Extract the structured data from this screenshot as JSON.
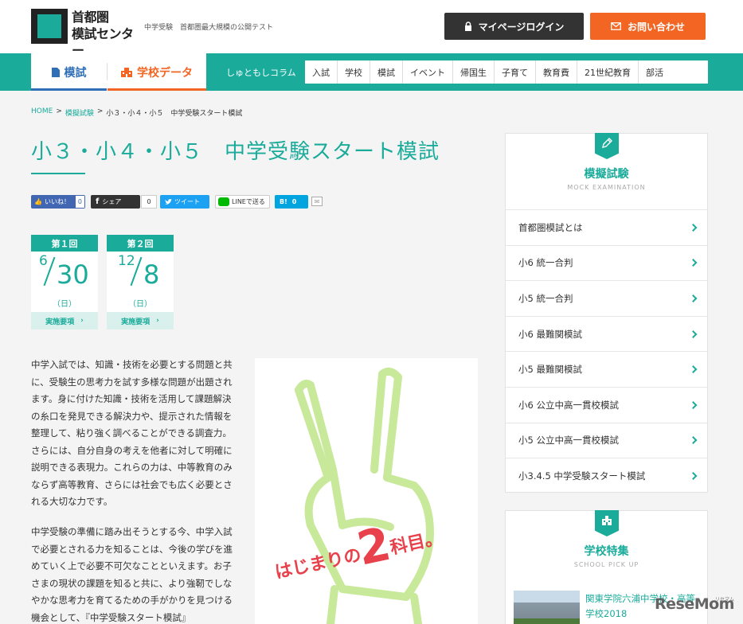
{
  "header": {
    "logo_text": "首都圏\n模試センター",
    "tagline": "中学受験　首都圏最大規模の公開テスト",
    "mypage_label": "マイページログイン",
    "contact_label": "お問い合わせ"
  },
  "nav": {
    "tab_moshi": "模試",
    "tab_school": "学校データ",
    "column_label": "しゅともしコラム",
    "categories": [
      "入試",
      "学校",
      "模試",
      "イベント",
      "帰国生",
      "子育て",
      "教育費",
      "21世紀教育",
      "部活"
    ]
  },
  "breadcrumb": {
    "home": "HOME",
    "sep": ">",
    "mock": "模擬試験",
    "current": "小３・小４・小５　中学受験スタート模試"
  },
  "page_title": "小３・小４・小５　中学受験スタート模試",
  "share": {
    "like_label": "いいね！",
    "like_count": "0",
    "fb_label": "シェア",
    "fb_count": "0",
    "tweet_label": "ツイート",
    "line_label": "LINEで送る",
    "hatena_label": "B!",
    "hatena_count": "0"
  },
  "exams": [
    {
      "round": "第１回",
      "month": "6",
      "day": "30",
      "dow": "（日）",
      "link": "実施要項"
    },
    {
      "round": "第２回",
      "month": "12",
      "day": "8",
      "dow": "（日）",
      "link": "実施要項"
    }
  ],
  "body": {
    "p1": "中学入試では、知識・技術を必要とする問題と共に、受験生の思考力を試す多様な問題が出題されます。身に付けた知識・技術を活用して課題解決の糸口を発見できる解決力や、提示された情報を整理して、粘り強く調べることができる調査力。さらには、自分自身の考えを他者に対して明確に説明できる表現力。これらの力は、中等教育のみならず高等教育、さらには社会でも広く必要とされる大切な力です。",
    "p2": "中学受験の準備に踏み出そうとする今、中学入試で必要とされる力を知ることは、今後の学びを進めていく上で必要不可欠なことといえます。お子さまの現状の課題を知ると共に、より強靭でしなやかな思考力を育てるための手がかりを見つける機会として、『中学受験スタート模試』"
  },
  "hero": {
    "text_a": "はじまりの",
    "text_b": "2",
    "text_c": "科目。"
  },
  "sidebar": {
    "title": "模擬試験",
    "subtitle": "MOCK EXAMINATION",
    "items": [
      "首都圏模試とは",
      "小6 統一合判",
      "小5 統一合判",
      "小6 最難関模試",
      "小5 最難関模試",
      "小6 公立中高一貫校模試",
      "小5 公立中高一貫校模試",
      "小3.4.5 中学受験スタート模試"
    ]
  },
  "sidebar2": {
    "title": "学校特集",
    "subtitle": "SCHOOL PICK UP",
    "school_name": "関東学院六浦中学校・高等学校2018"
  },
  "watermark": {
    "brand": "ReseMom",
    "sub": "リセマム"
  },
  "colors": {
    "teal": "#1aab9b",
    "orange": "#f26522",
    "blue": "#2e6fb8",
    "dark": "#333333",
    "hero_green": "#c8e89a",
    "hero_red": "#e8414b"
  }
}
